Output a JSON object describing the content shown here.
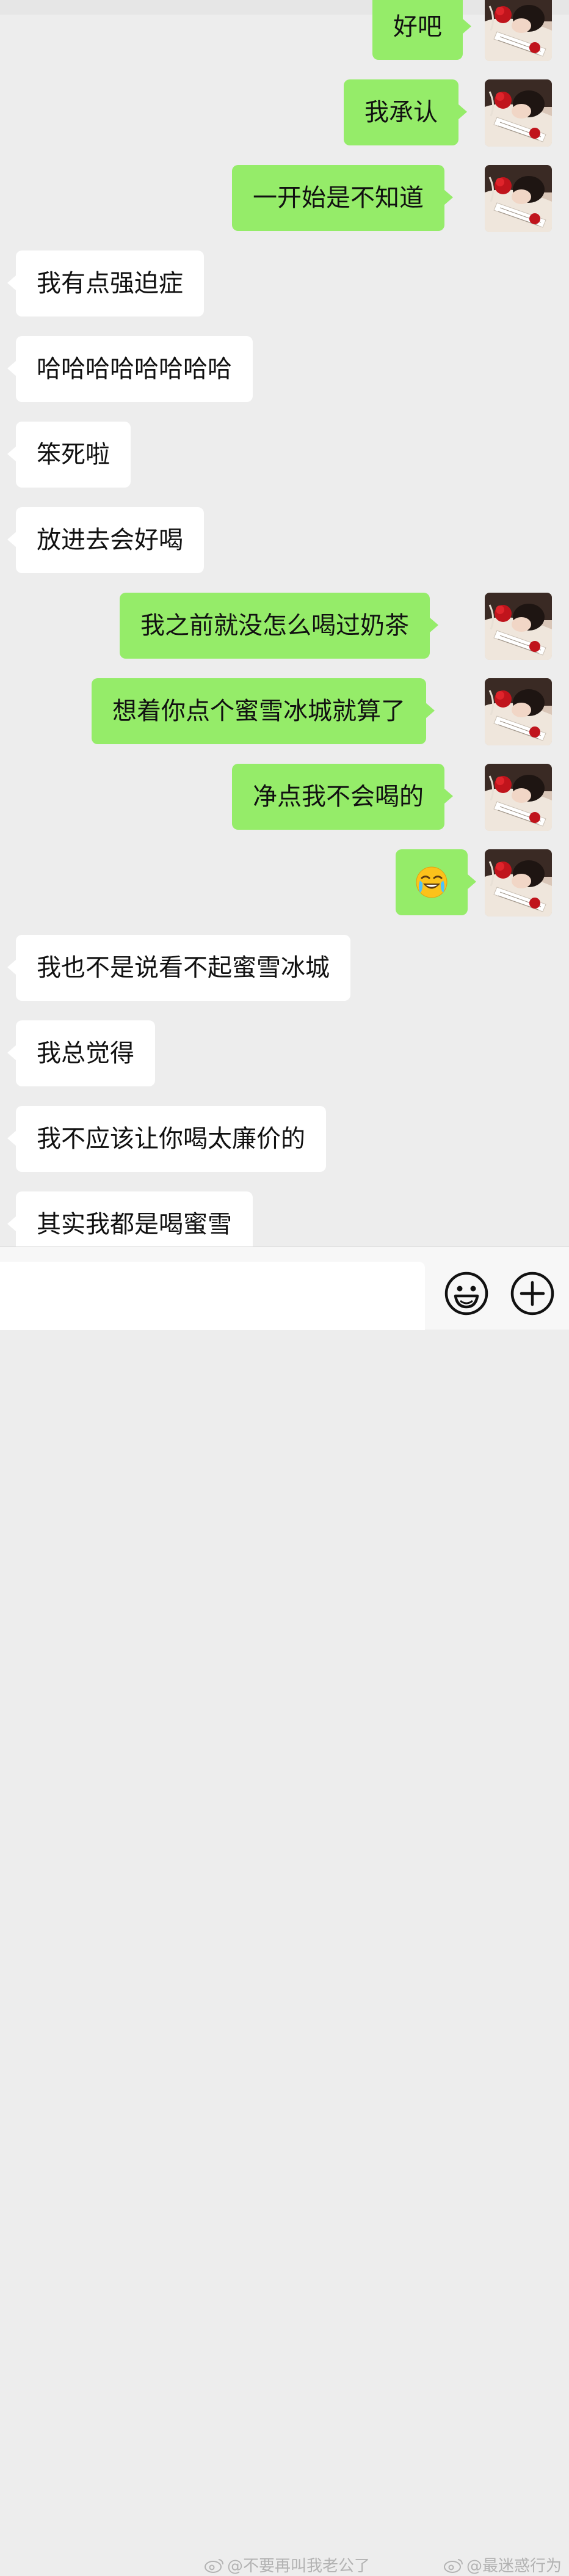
{
  "messages": [
    {
      "side": "right",
      "text": "好吧"
    },
    {
      "side": "right",
      "text": "我承认"
    },
    {
      "side": "right",
      "text": "一开始是不知道"
    },
    {
      "side": "left",
      "text": "我有点强迫症"
    },
    {
      "side": "left",
      "text": "哈哈哈哈哈哈哈哈"
    },
    {
      "side": "left",
      "text": "笨死啦"
    },
    {
      "side": "left",
      "text": "放进去会好喝"
    },
    {
      "side": "right",
      "text": "我之前就没怎么喝过奶茶"
    },
    {
      "side": "right",
      "text": "想着你点个蜜雪冰城就算了"
    },
    {
      "side": "right",
      "text": "净点我不会喝的"
    },
    {
      "side": "right",
      "emoji": "crying-laughing-emoji"
    },
    {
      "side": "left",
      "text": "我也不是说看不起蜜雪冰城"
    },
    {
      "side": "left",
      "text": "我总觉得"
    },
    {
      "side": "left",
      "text": "我不应该让你喝太廉价的"
    },
    {
      "side": "left",
      "text": "其实我都是喝蜜雪"
    }
  ],
  "input_bar": {
    "emoji_button_icon": "smiley-face-icon",
    "more_button_icon": "plus-circle-icon"
  },
  "watermarks": {
    "left": "@不要再叫我老公了",
    "right": "@最迷惑行为"
  },
  "colors": {
    "background": "#ededed",
    "self_bubble": "#95ec69",
    "other_bubble": "#ffffff"
  }
}
